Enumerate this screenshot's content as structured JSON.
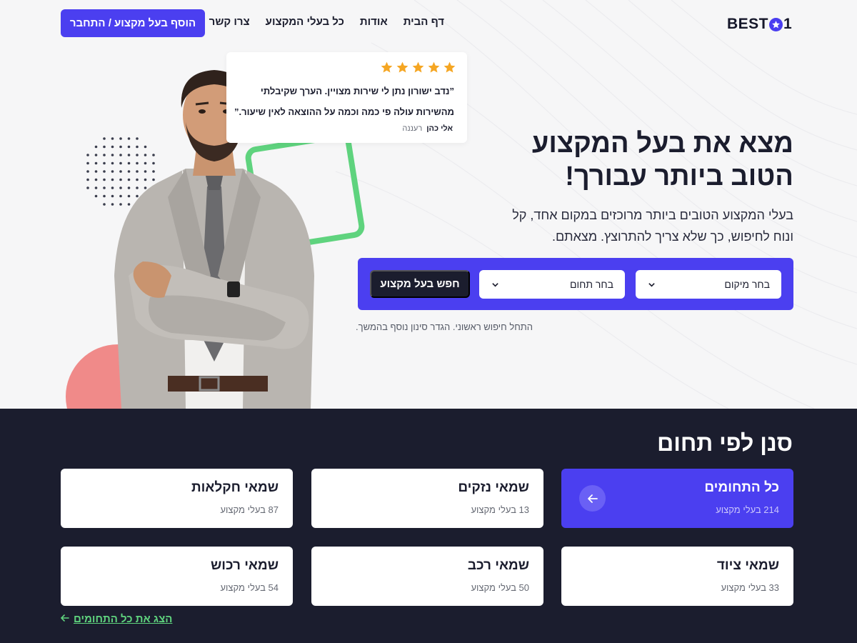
{
  "header": {
    "logo_text_left": "BEST",
    "logo_text_right": "1",
    "nav": [
      "דף הבית",
      "אודות",
      "כל בעלי המקצוע",
      "צרו קשר"
    ],
    "cta_label": "הוסף בעל מקצוע / התחבר"
  },
  "hero": {
    "title": "מצא את בעל המקצוע הטוב ביותר עבורך!",
    "subtitle": "בעלי המקצוע הטובים ביותר מרוכזים במקום אחד, קל ונוח לחיפוש, כך שלא צריך להתרוצץ. מצאתם.",
    "search": {
      "location_label": "בחר מיקום",
      "category_label": "בחר תחום",
      "button_label": "חפש בעל מקצוע",
      "hint": "התחל חיפוש ראשוני. הגדר סינון נוסף בהמשך."
    }
  },
  "review": {
    "rating": 5,
    "text": "”נדב ישורון נתן לי שירות מצויין. הערך שקיבלתי מהשירות עולה פי כמה וכמה על ההוצאה לאין שיעור.”",
    "author": "אלי כהן",
    "city": "רעננה"
  },
  "categories": {
    "title": "סנן לפי תחום",
    "items": [
      {
        "title": "כל התחומים",
        "count": "214 בעלי מקצוע"
      },
      {
        "title": "שמאי נזקים",
        "count": "13 בעלי מקצוע"
      },
      {
        "title": "שמאי חקלאות",
        "count": "87 בעלי מקצוע"
      },
      {
        "title": "שמאי ציוד",
        "count": "33 בעלי מקצוע"
      },
      {
        "title": "שמאי רכב",
        "count": "50 בעלי מקצוע"
      },
      {
        "title": "שמאי רכוש",
        "count": "54 בעלי מקצוע"
      }
    ],
    "show_all_label": "הצג את כל התחומים"
  },
  "colors": {
    "primary": "#4b3ff0",
    "dark": "#1b1d2e",
    "green": "#5fd37e",
    "coral": "#f08a89",
    "star": "#f5a623"
  }
}
